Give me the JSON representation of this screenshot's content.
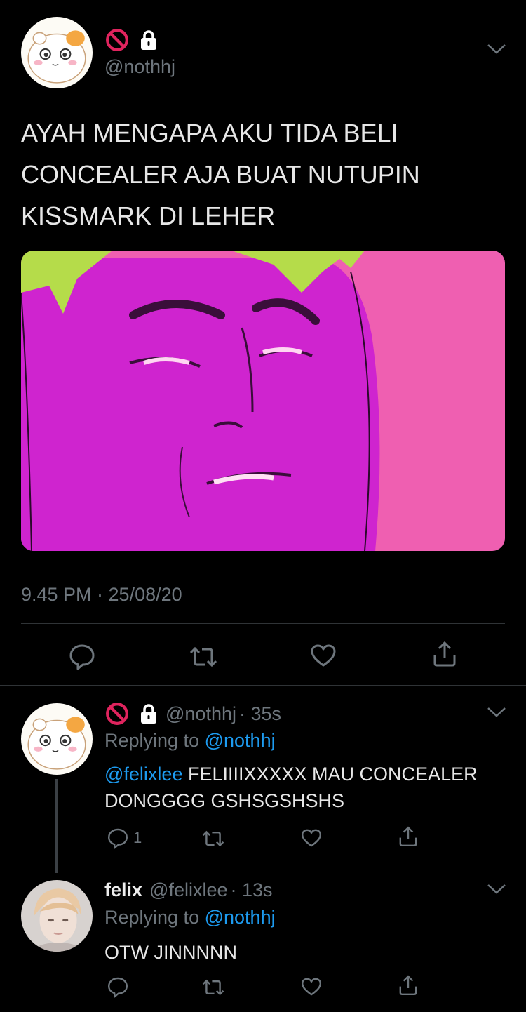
{
  "main_tweet": {
    "handle": "@nothhj",
    "text": "AYAH MENGAPA AKU TIDA BELI CONCEALER AJA BUAT NUTUPIN KISSMARK DI LEHER",
    "timestamp": "9.45 PM · 25/08/20",
    "icons": [
      "ban-icon",
      "lock-icon",
      "chevron-down-icon",
      "reply-icon",
      "retweet-icon",
      "like-icon",
      "share-icon"
    ]
  },
  "replies": [
    {
      "name": "",
      "handle": "@nothhj",
      "time": "· 35s",
      "replying_prefix": "Replying to",
      "replying_to": "@nothhj",
      "mention": "@felixlee",
      "text": "FELIIIIXXXXX MAU CONCEALER DONGGGG GSHSGSHSHS",
      "reply_count": "1"
    },
    {
      "name": "felix",
      "handle": "@felixlee",
      "time": "· 13s",
      "replying_prefix": "Replying to",
      "replying_to": "@nothhj",
      "text": "OTW JINNNNN",
      "reply_count": ""
    }
  ],
  "colors": {
    "background": "#000000",
    "text": "#e7e7e7",
    "muted": "#6e767d",
    "link": "#1d9bf0",
    "ban_red": "#e0245e"
  }
}
